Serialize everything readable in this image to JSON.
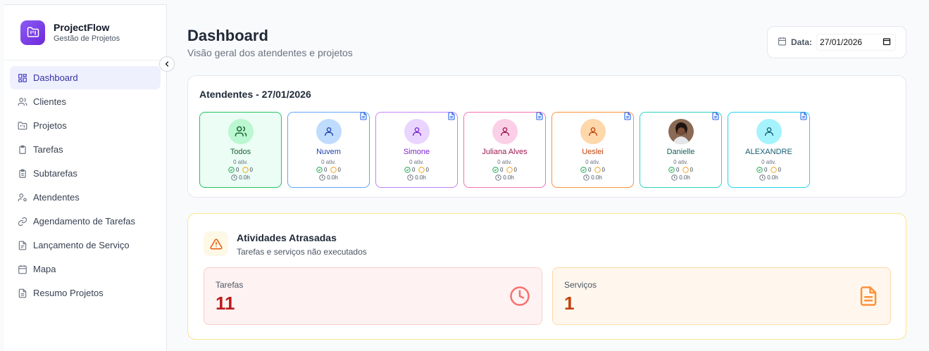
{
  "brand": {
    "title": "ProjectFlow",
    "subtitle": "Gestão de Projetos"
  },
  "sidebar": {
    "items": [
      {
        "label": "Dashboard",
        "icon": "dashboard-icon",
        "active": true
      },
      {
        "label": "Clientes",
        "icon": "users-icon"
      },
      {
        "label": "Projetos",
        "icon": "folder-icon"
      },
      {
        "label": "Tarefas",
        "icon": "clipboard-icon"
      },
      {
        "label": "Subtarefas",
        "icon": "clipboard-list-icon"
      },
      {
        "label": "Atendentes",
        "icon": "user-cog-icon"
      },
      {
        "label": "Agendamento de Tarefas",
        "icon": "link-icon"
      },
      {
        "label": "Lançamento de Serviço",
        "icon": "file-icon"
      },
      {
        "label": "Mapa",
        "icon": "calendar-icon"
      },
      {
        "label": "Resumo Projetos",
        "icon": "file-text-icon"
      }
    ]
  },
  "header": {
    "title": "Dashboard",
    "subtitle": "Visão geral dos atendentes e projetos"
  },
  "date_filter": {
    "label": "Data:",
    "value": "27/01/2026"
  },
  "attendants_section": {
    "title": "Atendentes - 27/01/2026",
    "items": [
      {
        "name": "Todos",
        "ativ": "0 ativ.",
        "done": "0",
        "pending": "0",
        "hours": "0.0h",
        "color": "#22c55e",
        "bg": "#ecfdf5",
        "avatar_bg": "#bbf7d0",
        "name_color": "#166534",
        "icon": "users-icon",
        "doc": false
      },
      {
        "name": "Nuvem",
        "ativ": "0 ativ.",
        "done": "0",
        "pending": "0",
        "hours": "0.0h",
        "color": "#60a5fa",
        "bg": "#ffffff",
        "avatar_bg": "#bfdbfe",
        "name_color": "#1e40af",
        "icon": "user-icon",
        "doc": true
      },
      {
        "name": "Simone",
        "ativ": "0 ativ.",
        "done": "0",
        "pending": "0",
        "hours": "0.0h",
        "color": "#c084fc",
        "bg": "#ffffff",
        "avatar_bg": "#e9d5ff",
        "name_color": "#7e22ce",
        "icon": "user-icon",
        "doc": true
      },
      {
        "name": "Juliana Alves",
        "ativ": "0 ativ.",
        "done": "0",
        "pending": "0",
        "hours": "0.0h",
        "color": "#f472b6",
        "bg": "#ffffff",
        "avatar_bg": "#fbcfe8",
        "name_color": "#9d174d",
        "icon": "user-icon",
        "doc": true
      },
      {
        "name": "Ueslei",
        "ativ": "0 ativ.",
        "done": "0",
        "pending": "0",
        "hours": "0.0h",
        "color": "#fb923c",
        "bg": "#ffffff",
        "avatar_bg": "#fed7aa",
        "name_color": "#c2410c",
        "icon": "user-icon",
        "doc": true
      },
      {
        "name": "Danielle",
        "ativ": "0 ativ.",
        "done": "0",
        "pending": "0",
        "hours": "0.0h",
        "color": "#2dd4bf",
        "bg": "#ffffff",
        "avatar_bg": "#6b4a3a",
        "name_color": "#115e59",
        "icon": "photo-avatar",
        "doc": true
      },
      {
        "name": "ALEXANDRE",
        "ativ": "0 ativ.",
        "done": "0",
        "pending": "0",
        "hours": "0.0h",
        "color": "#22d3ee",
        "bg": "#ffffff",
        "avatar_bg": "#a5f3fc",
        "name_color": "#155e75",
        "icon": "user-icon",
        "doc": true
      }
    ]
  },
  "late_section": {
    "title": "Atividades Atrasadas",
    "subtitle": "Tarefas e serviços não executados",
    "tarefas": {
      "label": "Tarefas",
      "value": "11",
      "icon": "clock-icon"
    },
    "servicos": {
      "label": "Serviços",
      "value": "1",
      "icon": "file-text-icon"
    }
  }
}
